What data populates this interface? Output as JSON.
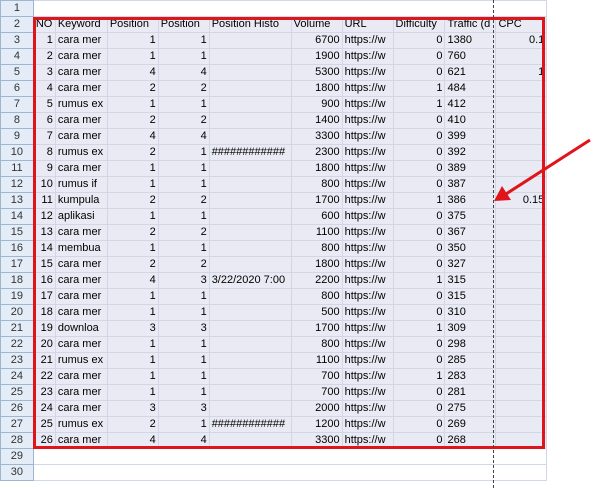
{
  "sheet": {
    "header_row_number": "2",
    "top_row_number": "1",
    "bottom_row_numbers": [
      "29",
      "30"
    ],
    "columns": [
      "NO",
      "Keyword",
      "Position",
      "Position",
      "Position Histo",
      "Volume",
      "URL",
      "Difficulty",
      "Traffic (d",
      "CPC"
    ],
    "rows": [
      {
        "row": "3",
        "no": "1",
        "keyword": "cara mer",
        "pos1": "1",
        "pos2": "1",
        "hist": "",
        "volume": "6700",
        "url": "https://w",
        "diff": "0",
        "traffic": "1380",
        "cpc": "0.1"
      },
      {
        "row": "4",
        "no": "2",
        "keyword": "cara mer",
        "pos1": "1",
        "pos2": "1",
        "hist": "",
        "volume": "1900",
        "url": "https://w",
        "diff": "0",
        "traffic": "760",
        "cpc": ""
      },
      {
        "row": "5",
        "no": "3",
        "keyword": "cara mer",
        "pos1": "4",
        "pos2": "4",
        "hist": "",
        "volume": "5300",
        "url": "https://w",
        "diff": "0",
        "traffic": "621",
        "cpc": "1"
      },
      {
        "row": "6",
        "no": "4",
        "keyword": "cara mer",
        "pos1": "2",
        "pos2": "2",
        "hist": "",
        "volume": "1800",
        "url": "https://w",
        "diff": "1",
        "traffic": "484",
        "cpc": ""
      },
      {
        "row": "7",
        "no": "5",
        "keyword": "rumus ex",
        "pos1": "1",
        "pos2": "1",
        "hist": "",
        "volume": "900",
        "url": "https://w",
        "diff": "1",
        "traffic": "412",
        "cpc": ""
      },
      {
        "row": "8",
        "no": "6",
        "keyword": "cara mer",
        "pos1": "2",
        "pos2": "2",
        "hist": "",
        "volume": "1400",
        "url": "https://w",
        "diff": "0",
        "traffic": "410",
        "cpc": ""
      },
      {
        "row": "9",
        "no": "7",
        "keyword": "cara mer",
        "pos1": "4",
        "pos2": "4",
        "hist": "",
        "volume": "3300",
        "url": "https://w",
        "diff": "0",
        "traffic": "399",
        "cpc": ""
      },
      {
        "row": "10",
        "no": "8",
        "keyword": "rumus ex",
        "pos1": "2",
        "pos2": "1",
        "hist": "############",
        "volume": "2300",
        "url": "https://w",
        "diff": "0",
        "traffic": "392",
        "cpc": ""
      },
      {
        "row": "11",
        "no": "9",
        "keyword": "cara mer",
        "pos1": "1",
        "pos2": "1",
        "hist": "",
        "volume": "1800",
        "url": "https://w",
        "diff": "0",
        "traffic": "389",
        "cpc": ""
      },
      {
        "row": "12",
        "no": "10",
        "keyword": "rumus if",
        "pos1": "1",
        "pos2": "1",
        "hist": "",
        "volume": "800",
        "url": "https://w",
        "diff": "0",
        "traffic": "387",
        "cpc": ""
      },
      {
        "row": "13",
        "no": "11",
        "keyword": "kumpula",
        "pos1": "2",
        "pos2": "2",
        "hist": "",
        "volume": "1700",
        "url": "https://w",
        "diff": "1",
        "traffic": "386",
        "cpc": "0.15"
      },
      {
        "row": "14",
        "no": "12",
        "keyword": "aplikasi",
        "pos1": "1",
        "pos2": "1",
        "hist": "",
        "volume": "600",
        "url": "https://w",
        "diff": "0",
        "traffic": "375",
        "cpc": ""
      },
      {
        "row": "15",
        "no": "13",
        "keyword": "cara mer",
        "pos1": "2",
        "pos2": "2",
        "hist": "",
        "volume": "1100",
        "url": "https://w",
        "diff": "0",
        "traffic": "367",
        "cpc": ""
      },
      {
        "row": "16",
        "no": "14",
        "keyword": "membua",
        "pos1": "1",
        "pos2": "1",
        "hist": "",
        "volume": "800",
        "url": "https://w",
        "diff": "0",
        "traffic": "350",
        "cpc": ""
      },
      {
        "row": "17",
        "no": "15",
        "keyword": "cara mer",
        "pos1": "2",
        "pos2": "2",
        "hist": "",
        "volume": "1800",
        "url": "https://w",
        "diff": "0",
        "traffic": "327",
        "cpc": ""
      },
      {
        "row": "18",
        "no": "16",
        "keyword": "cara mer",
        "pos1": "4",
        "pos2": "3",
        "hist": "3/22/2020 7:00",
        "volume": "2200",
        "url": "https://w",
        "diff": "1",
        "traffic": "315",
        "cpc": ""
      },
      {
        "row": "19",
        "no": "17",
        "keyword": "cara mer",
        "pos1": "1",
        "pos2": "1",
        "hist": "",
        "volume": "800",
        "url": "https://w",
        "diff": "0",
        "traffic": "315",
        "cpc": ""
      },
      {
        "row": "20",
        "no": "18",
        "keyword": "cara mer",
        "pos1": "1",
        "pos2": "1",
        "hist": "",
        "volume": "500",
        "url": "https://w",
        "diff": "0",
        "traffic": "310",
        "cpc": ""
      },
      {
        "row": "21",
        "no": "19",
        "keyword": "downloa",
        "pos1": "3",
        "pos2": "3",
        "hist": "",
        "volume": "1700",
        "url": "https://w",
        "diff": "1",
        "traffic": "309",
        "cpc": ""
      },
      {
        "row": "22",
        "no": "20",
        "keyword": "cara mer",
        "pos1": "1",
        "pos2": "1",
        "hist": "",
        "volume": "800",
        "url": "https://w",
        "diff": "0",
        "traffic": "298",
        "cpc": ""
      },
      {
        "row": "23",
        "no": "21",
        "keyword": "rumus ex",
        "pos1": "1",
        "pos2": "1",
        "hist": "",
        "volume": "1100",
        "url": "https://w",
        "diff": "0",
        "traffic": "285",
        "cpc": ""
      },
      {
        "row": "24",
        "no": "22",
        "keyword": "cara mer",
        "pos1": "1",
        "pos2": "1",
        "hist": "",
        "volume": "700",
        "url": "https://w",
        "diff": "1",
        "traffic": "283",
        "cpc": ""
      },
      {
        "row": "25",
        "no": "23",
        "keyword": "cara mer",
        "pos1": "1",
        "pos2": "1",
        "hist": "",
        "volume": "700",
        "url": "https://w",
        "diff": "0",
        "traffic": "281",
        "cpc": ""
      },
      {
        "row": "26",
        "no": "24",
        "keyword": "cara mer",
        "pos1": "3",
        "pos2": "3",
        "hist": "",
        "volume": "2000",
        "url": "https://w",
        "diff": "0",
        "traffic": "275",
        "cpc": ""
      },
      {
        "row": "27",
        "no": "25",
        "keyword": "rumus ex",
        "pos1": "2",
        "pos2": "1",
        "hist": "############",
        "volume": "1200",
        "url": "https://w",
        "diff": "0",
        "traffic": "269",
        "cpc": ""
      },
      {
        "row": "28",
        "no": "26",
        "keyword": "cara mer",
        "pos1": "4",
        "pos2": "4",
        "hist": "",
        "volume": "3300",
        "url": "https://w",
        "diff": "0",
        "traffic": "268",
        "cpc": ""
      }
    ]
  },
  "annotation": {
    "highlight_color": "#e0151b",
    "frame_icon": "red-selection-rectangle",
    "arrow_icon": "red-arrow-pointing-to-cell"
  }
}
